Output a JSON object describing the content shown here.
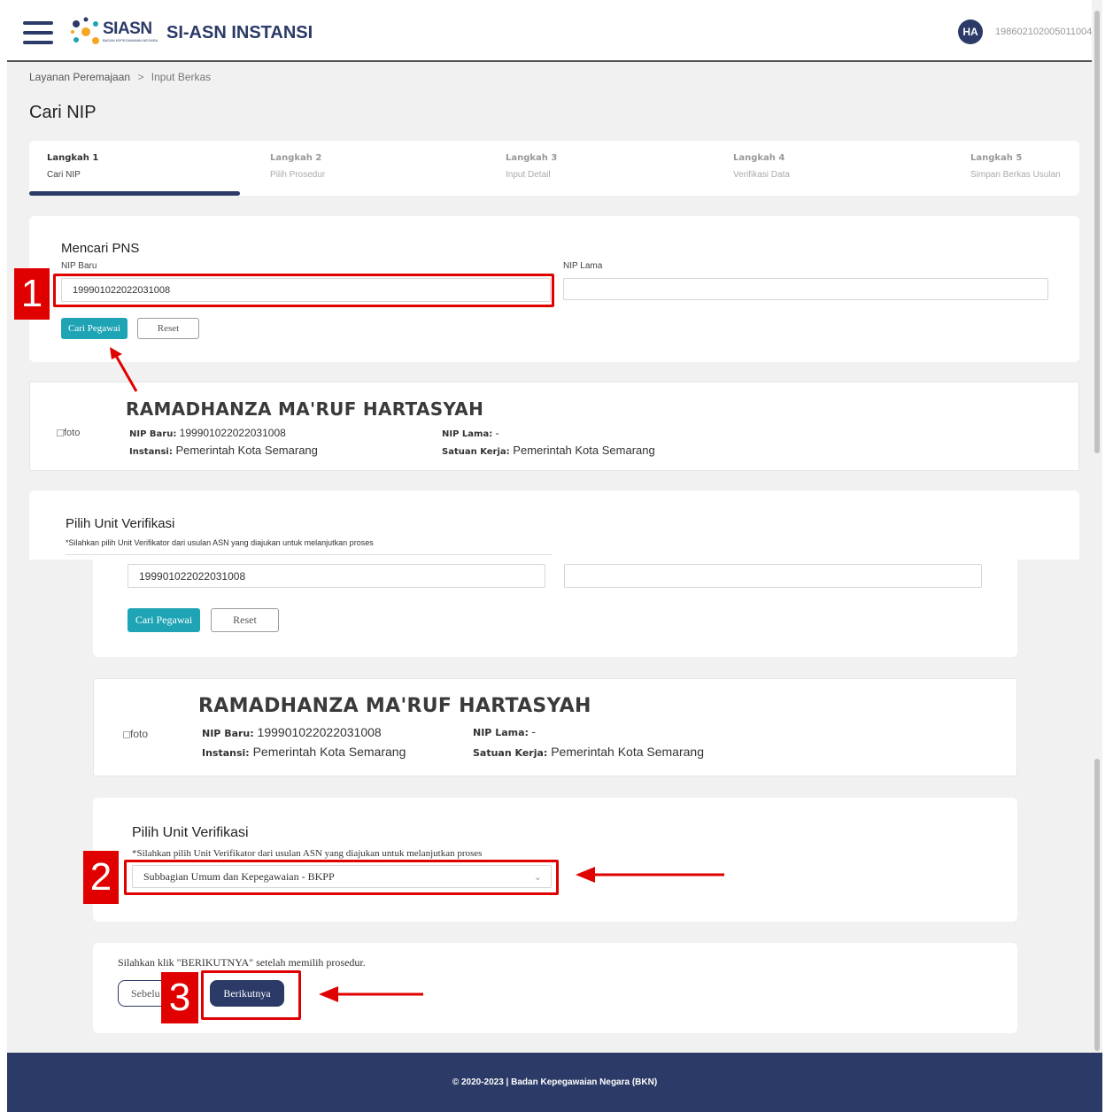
{
  "header": {
    "logo_text": "SIASN",
    "logo_sub": "BADAN KEPEGAWAIAN NEGARA",
    "app_title": "SI-ASN INSTANSI",
    "avatar_initials": "HA",
    "user_nip": "198602102005011004"
  },
  "breadcrumb": {
    "parent": "Layanan Peremajaan",
    "separator": ">",
    "current": "Input Berkas"
  },
  "page_title": "Cari NIP",
  "steps": [
    {
      "title": "Langkah 1",
      "subtitle": "Cari NIP"
    },
    {
      "title": "Langkah 2",
      "subtitle": "Pilih Prosedur"
    },
    {
      "title": "Langkah 3",
      "subtitle": "Input Detail"
    },
    {
      "title": "Langkah 4",
      "subtitle": "Verifikasi Data"
    },
    {
      "title": "Langkah 5",
      "subtitle": "Simpan Berkas Usulan"
    }
  ],
  "search": {
    "heading": "Mencari PNS",
    "nip_baru_label": "NIP Baru",
    "nip_baru_value": "199901022022031008",
    "nip_lama_label": "NIP Lama",
    "nip_lama_value": "",
    "search_button": "Cari Pegawai",
    "reset_button": "Reset"
  },
  "employee": {
    "photo_alt": "foto",
    "name": "RAMADHANZA MA'RUF HARTASYAH",
    "nip_baru_label": "NIP Baru:",
    "nip_baru": "199901022022031008",
    "nip_lama_label": "NIP Lama:",
    "nip_lama": "-",
    "instansi_label": "Instansi:",
    "instansi": "Pemerintah Kota Semarang",
    "satker_label": "Satuan Kerja:",
    "satker": "Pemerintah Kota Semarang"
  },
  "verifikasi": {
    "heading": "Pilih Unit Verifikasi",
    "hint": "*Silahkan pilih Unit Verifikator dari usulan ASN yang diajukan untuk melanjutkan proses",
    "selected": "Subbagian Umum dan Kepegawaian - BKPP"
  },
  "actions": {
    "hint": "Silahkan klik \"BERIKUTNYA\" setelah memilih prosedur.",
    "prev_button_partial": "Sebelu",
    "next_button": "Berikutnya"
  },
  "annotations": {
    "badge_1": "1",
    "badge_2": "2",
    "badge_3": "3"
  },
  "footer": {
    "text": "© 2020-2023 | Badan Kepegawaian Negara (BKN)"
  },
  "colors": {
    "brand_navy": "#2b3a67",
    "teal": "#1fa4b5",
    "annotation_red": "#e00000",
    "step_active": "#2b3a67"
  }
}
